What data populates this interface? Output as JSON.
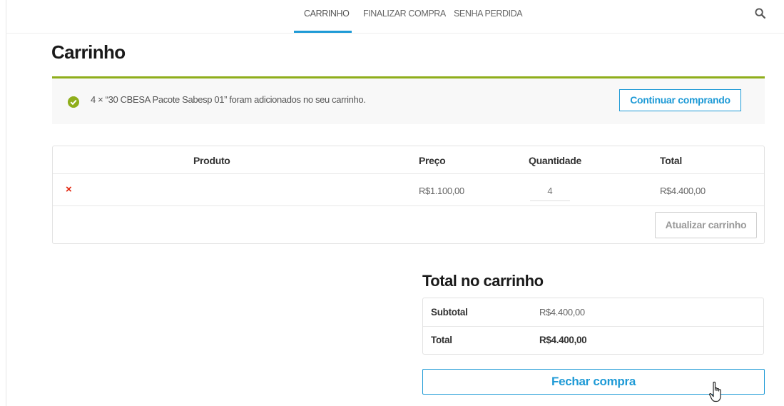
{
  "nav": {
    "items": [
      {
        "label": "CARRINHO",
        "active": true
      },
      {
        "label": "FINALIZAR COMPRA",
        "active": false
      },
      {
        "label": "SENHA PERDIDA",
        "active": false
      }
    ],
    "search_icon": "search-icon",
    "accent_color": "#1e9ad6"
  },
  "page": {
    "title": "Carrinho"
  },
  "notice": {
    "icon": "check-circle-icon",
    "message": "4 × “30 CBESA Pacote Sabesp 01” foram adicionados no seu carrinho.",
    "continue_label": "Continuar comprando",
    "color": "#8fae1b"
  },
  "cart": {
    "headers": {
      "product": "Produto",
      "price": "Preço",
      "quantity": "Quantidade",
      "total": "Total"
    },
    "rows": [
      {
        "remove": "×",
        "product": "",
        "price": "R$1.100,00",
        "quantity": "4",
        "total": "R$4.400,00"
      }
    ],
    "update_label": "Atualizar carrinho"
  },
  "totals": {
    "title": "Total no carrinho",
    "subtotal_label": "Subtotal",
    "subtotal_value": "R$4.400,00",
    "total_label": "Total",
    "total_value": "R$4.400,00",
    "checkout_label": "Fechar compra"
  },
  "cursor": "hand-pointer-icon"
}
